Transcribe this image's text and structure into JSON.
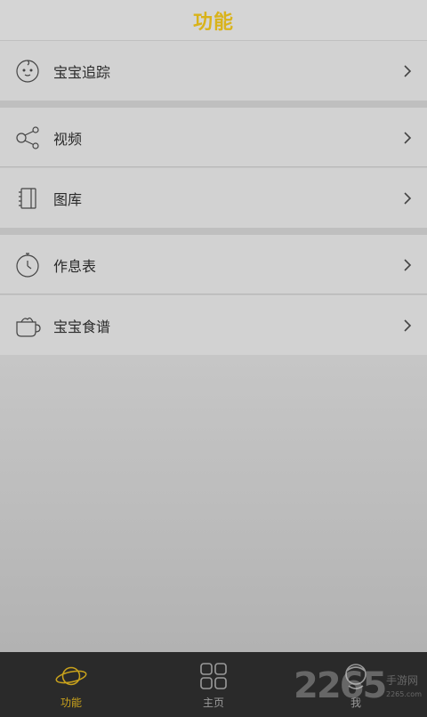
{
  "header": {
    "title": "功能"
  },
  "menu": {
    "items": [
      {
        "label": "宝宝追踪",
        "icon": "baby-face-icon"
      },
      {
        "label": "视频",
        "icon": "share-icon"
      },
      {
        "label": "图库",
        "icon": "gallery-icon"
      },
      {
        "label": "作息表",
        "icon": "stopwatch-icon"
      },
      {
        "label": "宝宝食谱",
        "icon": "cup-icon"
      }
    ]
  },
  "tabbar": {
    "tabs": [
      {
        "label": "功能",
        "icon": "planet-icon",
        "active": true
      },
      {
        "label": "主页",
        "icon": "grid-icon",
        "active": false
      },
      {
        "label": "我",
        "icon": "profile-icon",
        "active": false
      }
    ]
  },
  "watermark": {
    "number": "2265",
    "text": "手游网",
    "url": "2265.com"
  },
  "colors": {
    "accent": "#d9b31a",
    "tabbar_bg": "#2a2a2a",
    "list_bg": "#d2d2d2"
  }
}
